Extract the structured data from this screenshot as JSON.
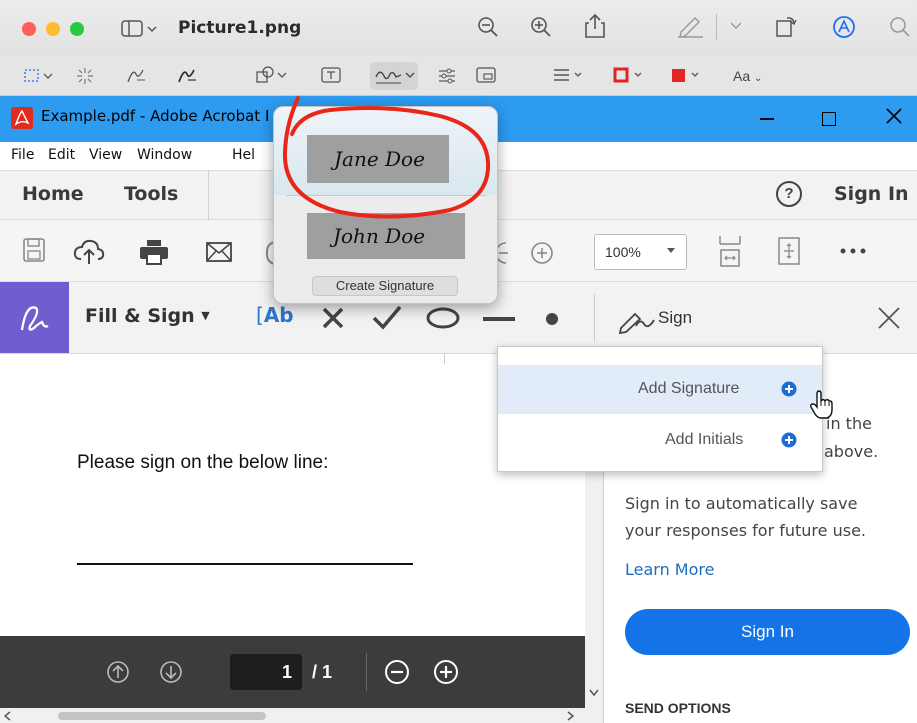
{
  "mac": {
    "window_title": "Picture1.png",
    "toolbar_text_label": "Aa"
  },
  "acrobat": {
    "title": "Example.pdf - Adobe Acrobat I",
    "menu": [
      "File",
      "Edit",
      "View",
      "Window",
      "Hel"
    ],
    "nav": {
      "home": "Home",
      "tools": "Tools",
      "help": "?",
      "sign_in": "Sign In"
    },
    "zoom": "100%",
    "fill_sign": {
      "label": "Fill & Sign",
      "text_tool": "Ab",
      "sign_label": "Sign"
    }
  },
  "signature_popover": {
    "signatures": [
      "Jane Doe",
      "John Doe"
    ],
    "create_label": "Create Signature"
  },
  "sign_dropdown": {
    "add_signature": "Add Signature",
    "add_initials": "Add Initials"
  },
  "document": {
    "prompt": "Please sign on the below line:",
    "page_current": "1",
    "page_total": "/ 1"
  },
  "right_panel": {
    "partial_line1": "in the",
    "partial_line2": "above.",
    "autosave_text_1": "Sign in to automatically save",
    "autosave_text_2": "your responses for future use.",
    "learn_more": "Learn More",
    "sign_in_button": "Sign In",
    "send_options": "SEND OPTIONS"
  },
  "colors": {
    "acrobat_titlebar": "#2d9bf0",
    "accent_blue": "#1473e6",
    "annotation_red": "#e8261a"
  }
}
